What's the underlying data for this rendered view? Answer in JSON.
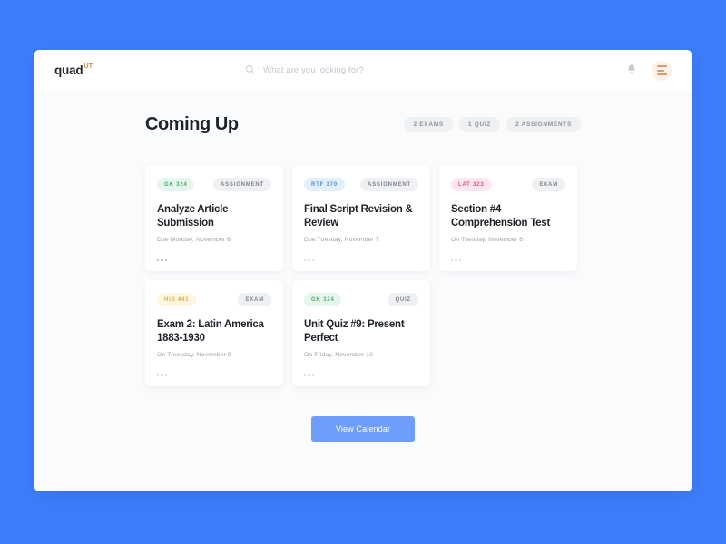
{
  "theme": {
    "page_background": "#3d7efd",
    "panel_background": "#ffffff",
    "body_background": "#fafbfc",
    "accent_orange": "#d99b6a",
    "button_blue": "#6f9dfb"
  },
  "header": {
    "logo_text": "quad",
    "logo_superscript": "UT",
    "search_placeholder": "What are you looking for?",
    "search_value": "",
    "search_icon": "search-icon",
    "notification_icon": "bell-icon",
    "menu_icon": "menu-icon"
  },
  "main": {
    "title": "Coming Up",
    "pills": [
      {
        "label": "2 EXAMS"
      },
      {
        "label": "1 QUIZ"
      },
      {
        "label": "2 ASSIGNMENTS"
      }
    ],
    "cards": [
      {
        "course": "GK 324",
        "course_color": "#4fa86b",
        "course_bg": "#e6f6ec",
        "type": "ASSIGNMENT",
        "title": "Analyze Article Submission",
        "due": "Due Monday, November 6",
        "more_label": "more-options"
      },
      {
        "course": "RTF 370",
        "course_color": "#4a8fd4",
        "course_bg": "#e3f0fc",
        "type": "ASSIGNMENT",
        "title": "Final Script Revision & Review",
        "due": "Due Tuesday, November 7",
        "more_label": "more-options"
      },
      {
        "course": "LAT 323",
        "course_color": "#e0507f",
        "course_bg": "#fde6ee",
        "type": "EXAM",
        "title": "Section #4 Comprehension Test",
        "due": "On Tuesday, November 6",
        "more_label": "more-options"
      },
      {
        "course": "HIS 441",
        "course_color": "#e0a93c",
        "course_bg": "#fdf6e0",
        "type": "EXAM",
        "title": "Exam 2: Latin America 1883-1930",
        "due": "On Thursday, November 9",
        "more_label": "more-options"
      },
      {
        "course": "GK 324",
        "course_color": "#4fa86b",
        "course_bg": "#e6f6ec",
        "type": "QUIZ",
        "title": "Unit Quiz #9: Present Perfect",
        "due": "On Friday, November 10",
        "more_label": "more-options"
      }
    ],
    "view_calendar_label": "View Calendar"
  }
}
